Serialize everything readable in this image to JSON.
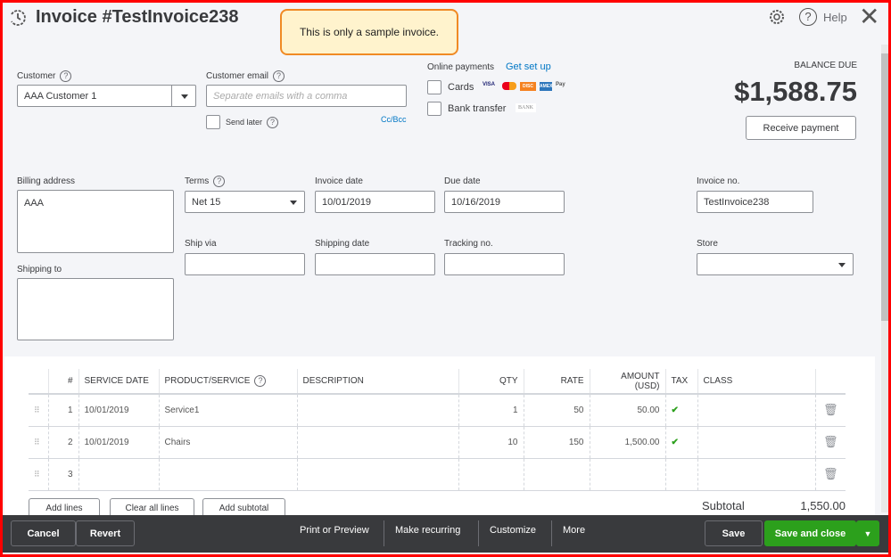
{
  "header": {
    "title": "Invoice #TestInvoice238",
    "notice": "This is only a sample invoice.",
    "help": "Help"
  },
  "customer": {
    "label": "Customer",
    "value": "AAA Customer 1"
  },
  "email": {
    "label": "Customer email",
    "placeholder": "Separate emails with a comma",
    "send_later": "Send later",
    "cc_bcc": "Cc/Bcc"
  },
  "online_payments": {
    "label": "Online payments",
    "setup": "Get set up",
    "cards": "Cards",
    "bank": "Bank transfer",
    "bank_badge": "BANK",
    "card_brands": [
      "VISA",
      "MC",
      "DISC",
      "AMEX",
      "Pay"
    ]
  },
  "balance": {
    "label": "BALANCE DUE",
    "amount": "$1,588.75",
    "receive": "Receive payment"
  },
  "billing": {
    "label": "Billing address",
    "value": "AAA",
    "shipping_label": "Shipping to"
  },
  "terms": {
    "label": "Terms",
    "value": "Net 15"
  },
  "invoice_date": {
    "label": "Invoice date",
    "value": "10/01/2019"
  },
  "due_date": {
    "label": "Due date",
    "value": "10/16/2019"
  },
  "invoice_no": {
    "label": "Invoice no.",
    "value": "TestInvoice238"
  },
  "ship_via": {
    "label": "Ship via"
  },
  "shipping_date": {
    "label": "Shipping date"
  },
  "tracking": {
    "label": "Tracking no."
  },
  "store": {
    "label": "Store"
  },
  "table": {
    "headers": [
      "#",
      "SERVICE DATE",
      "PRODUCT/SERVICE",
      "DESCRIPTION",
      "QTY",
      "RATE",
      "AMOUNT (USD)",
      "TAX",
      "CLASS"
    ],
    "rows": [
      {
        "num": "1",
        "date": "10/01/2019",
        "product": "Service1",
        "description": "",
        "qty": "1",
        "rate": "50",
        "amount": "50.00",
        "tax": "✔",
        "class": ""
      },
      {
        "num": "2",
        "date": "10/01/2019",
        "product": "Chairs",
        "description": "",
        "qty": "10",
        "rate": "150",
        "amount": "1,500.00",
        "tax": "✔",
        "class": ""
      },
      {
        "num": "3",
        "date": "",
        "product": "",
        "description": "",
        "qty": "",
        "rate": "",
        "amount": "",
        "tax": "",
        "class": ""
      }
    ]
  },
  "actions": {
    "add_lines": "Add lines",
    "clear_lines": "Clear all lines",
    "add_subtotal": "Add subtotal",
    "subtotal_label": "Subtotal",
    "subtotal": "1,550.00"
  },
  "footer": {
    "cancel": "Cancel",
    "revert": "Revert",
    "print": "Print or Preview",
    "recurring": "Make recurring",
    "customize": "Customize",
    "more": "More",
    "save": "Save",
    "save_close": "Save and close"
  }
}
